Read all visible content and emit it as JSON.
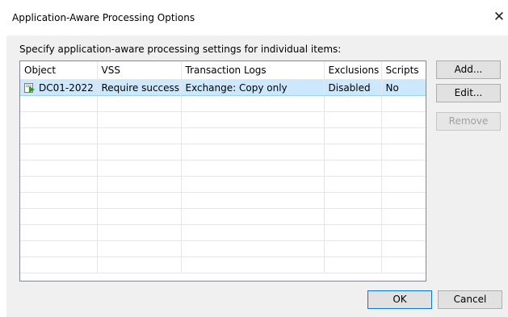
{
  "window": {
    "title": "Application-Aware Processing Options",
    "close_glyph": "✕"
  },
  "prompt": "Specify application-aware processing settings for individual items:",
  "grid": {
    "columns": [
      "Object",
      "VSS",
      "Transaction Logs",
      "Exclusions",
      "Scripts"
    ],
    "rows": [
      [
        "DC01-2022",
        "Require success",
        "Exchange: Copy only",
        "Disabled",
        "No"
      ]
    ],
    "object_icon": "vm-icon"
  },
  "buttons": {
    "add": "Add...",
    "edit": "Edit...",
    "remove": "Remove",
    "ok": "OK",
    "cancel": "Cancel"
  },
  "colors": {
    "selection": "#cce8ff",
    "icon_green": "#2e9a2e"
  }
}
